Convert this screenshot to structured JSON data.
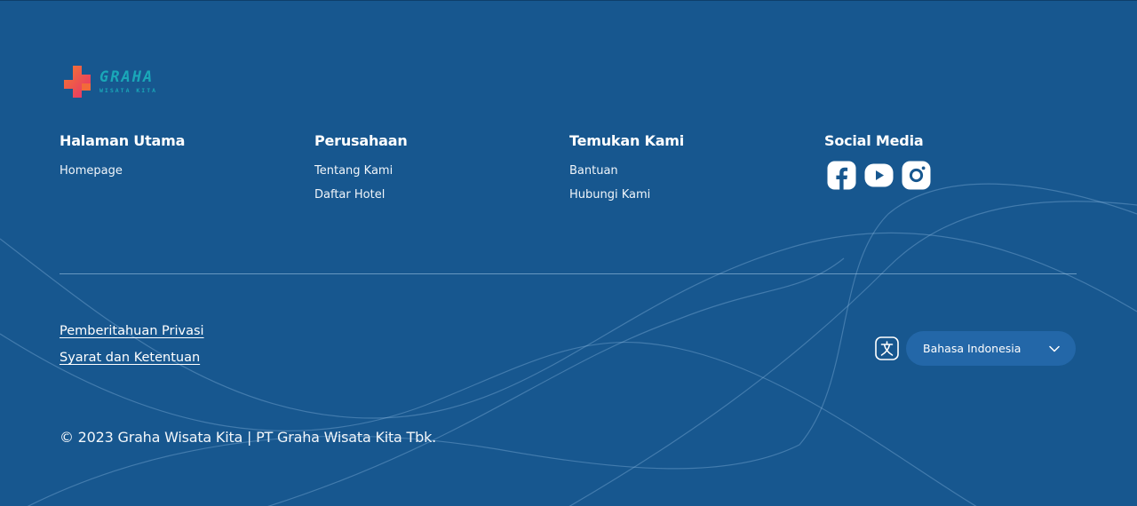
{
  "brand": {
    "logo_word": "GRAHA",
    "logo_sub": "WISATA KITA",
    "logo_mark_colors": [
      "#f1623b",
      "#e6316a"
    ],
    "logo_text_color": "#1aa7b8"
  },
  "columns": [
    {
      "title": "Halaman Utama",
      "links": [
        "Homepage"
      ]
    },
    {
      "title": "Perusahaan",
      "links": [
        "Tentang Kami",
        "Daftar Hotel"
      ]
    },
    {
      "title": "Temukan Kami",
      "links": [
        "Bantuan",
        "Hubungi Kami"
      ]
    },
    {
      "title": "Social Media",
      "icons": [
        "facebook-icon",
        "youtube-icon",
        "instagram-icon"
      ]
    }
  ],
  "legal": {
    "privacy": "Pemberitahuan Privasi",
    "terms": "Syarat dan Ketentuan"
  },
  "language": {
    "icon": "translate-icon",
    "selected": "Bahasa Indonesia"
  },
  "copyright": "© 2023 Graha Wisata Kita | PT Graha Wisata Kita Tbk.",
  "colors": {
    "background": "#17578f",
    "select_background": "#2367a8",
    "text": "#ffffff"
  }
}
